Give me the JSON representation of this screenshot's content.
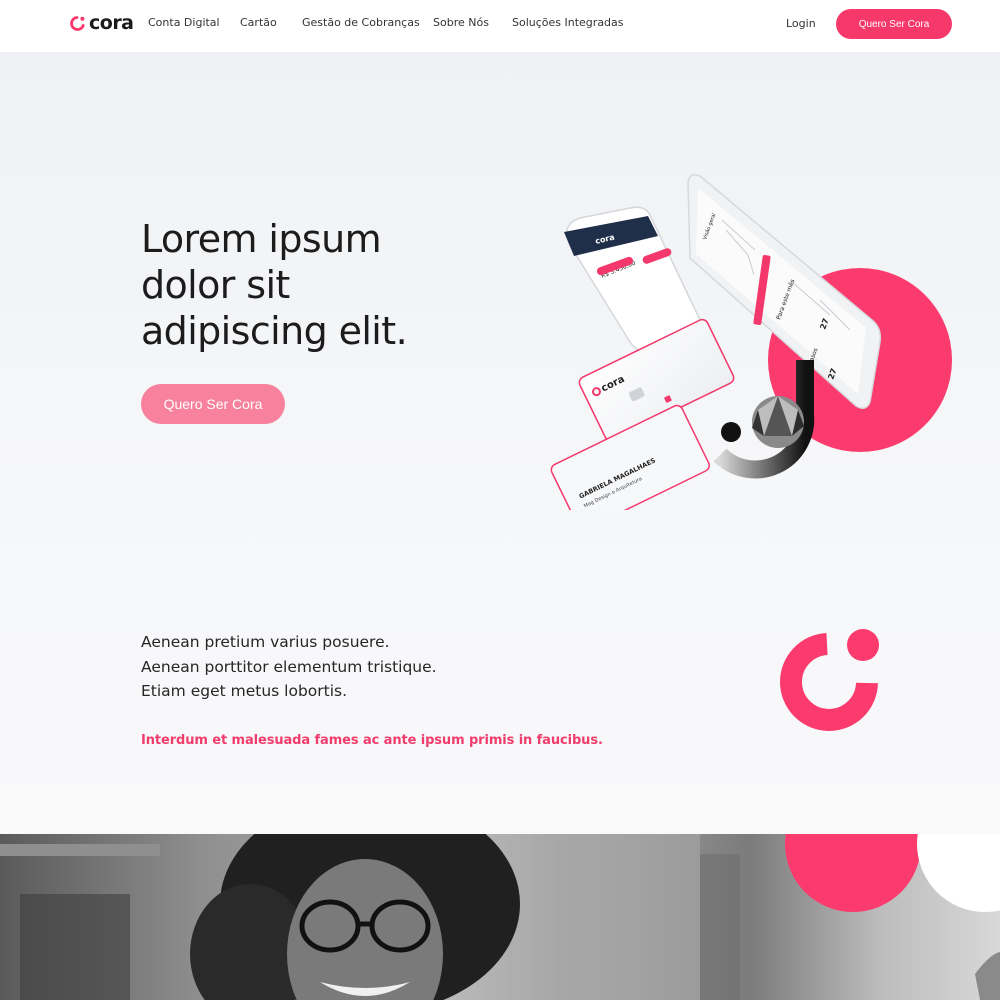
{
  "brand": {
    "name": "cora",
    "accent": "#f7386b"
  },
  "nav": {
    "items": [
      {
        "label": "Conta Digital"
      },
      {
        "label": "Cartão"
      },
      {
        "label": "Gestão de Cobranças"
      },
      {
        "label": "Sobre Nós"
      },
      {
        "label": "Soluções Integradas"
      }
    ],
    "login": "Login",
    "cta": "Quero Ser Cora"
  },
  "hero": {
    "title_lines": [
      "Lorem ipsum",
      "dolor sit",
      "adipiscing elit."
    ],
    "cta": "Quero Ser Cora",
    "card_front": {
      "brand": "cora"
    },
    "card_back": {
      "name": "GABRIELA MAGALHAES",
      "company": "Mag Design e Arquitetura"
    },
    "phone": {
      "brand": "cora",
      "balance": "R$ 3.456,00"
    }
  },
  "section": {
    "lines": [
      "Aenean pretium varius posuere.",
      "Aenean porttitor elementum tristique.",
      "Etiam eget metus lobortis."
    ],
    "accent": "Interdum et malesuada fames ac ante ipsum primis in faucibus."
  },
  "icons": {
    "logo": "cora-logo-icon",
    "hero_art": "phone-and-cards-illustration",
    "big_logo": "cora-logo-icon",
    "photo": "smiling-woman-photo"
  }
}
